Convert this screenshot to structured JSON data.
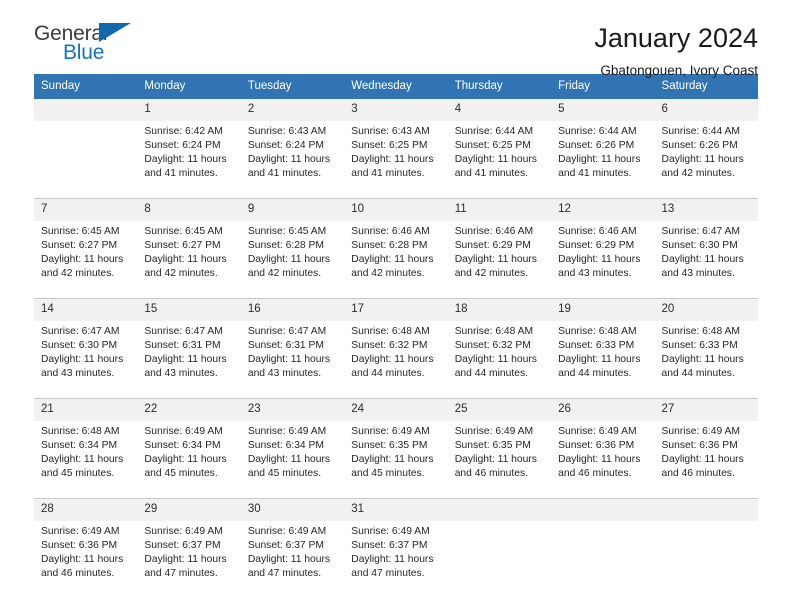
{
  "brand": {
    "name_part1": "General",
    "name_part2": "Blue",
    "triangle_color": "#1268ad"
  },
  "header": {
    "title": "January 2024",
    "subtitle": "Gbatongouen, Ivory Coast",
    "accent_color": "#3174b4",
    "daynum_band_color": "#f1f1f1"
  },
  "calendar": {
    "weekday_headers": [
      "Sunday",
      "Monday",
      "Tuesday",
      "Wednesday",
      "Thursday",
      "Friday",
      "Saturday"
    ],
    "weeks": [
      [
        {
          "day": "",
          "lines": []
        },
        {
          "day": "1",
          "lines": [
            "Sunrise: 6:42 AM",
            "Sunset: 6:24 PM",
            "Daylight: 11 hours",
            "and 41 minutes."
          ]
        },
        {
          "day": "2",
          "lines": [
            "Sunrise: 6:43 AM",
            "Sunset: 6:24 PM",
            "Daylight: 11 hours",
            "and 41 minutes."
          ]
        },
        {
          "day": "3",
          "lines": [
            "Sunrise: 6:43 AM",
            "Sunset: 6:25 PM",
            "Daylight: 11 hours",
            "and 41 minutes."
          ]
        },
        {
          "day": "4",
          "lines": [
            "Sunrise: 6:44 AM",
            "Sunset: 6:25 PM",
            "Daylight: 11 hours",
            "and 41 minutes."
          ]
        },
        {
          "day": "5",
          "lines": [
            "Sunrise: 6:44 AM",
            "Sunset: 6:26 PM",
            "Daylight: 11 hours",
            "and 41 minutes."
          ]
        },
        {
          "day": "6",
          "lines": [
            "Sunrise: 6:44 AM",
            "Sunset: 6:26 PM",
            "Daylight: 11 hours",
            "and 42 minutes."
          ]
        }
      ],
      [
        {
          "day": "7",
          "lines": [
            "Sunrise: 6:45 AM",
            "Sunset: 6:27 PM",
            "Daylight: 11 hours",
            "and 42 minutes."
          ]
        },
        {
          "day": "8",
          "lines": [
            "Sunrise: 6:45 AM",
            "Sunset: 6:27 PM",
            "Daylight: 11 hours",
            "and 42 minutes."
          ]
        },
        {
          "day": "9",
          "lines": [
            "Sunrise: 6:45 AM",
            "Sunset: 6:28 PM",
            "Daylight: 11 hours",
            "and 42 minutes."
          ]
        },
        {
          "day": "10",
          "lines": [
            "Sunrise: 6:46 AM",
            "Sunset: 6:28 PM",
            "Daylight: 11 hours",
            "and 42 minutes."
          ]
        },
        {
          "day": "11",
          "lines": [
            "Sunrise: 6:46 AM",
            "Sunset: 6:29 PM",
            "Daylight: 11 hours",
            "and 42 minutes."
          ]
        },
        {
          "day": "12",
          "lines": [
            "Sunrise: 6:46 AM",
            "Sunset: 6:29 PM",
            "Daylight: 11 hours",
            "and 43 minutes."
          ]
        },
        {
          "day": "13",
          "lines": [
            "Sunrise: 6:47 AM",
            "Sunset: 6:30 PM",
            "Daylight: 11 hours",
            "and 43 minutes."
          ]
        }
      ],
      [
        {
          "day": "14",
          "lines": [
            "Sunrise: 6:47 AM",
            "Sunset: 6:30 PM",
            "Daylight: 11 hours",
            "and 43 minutes."
          ]
        },
        {
          "day": "15",
          "lines": [
            "Sunrise: 6:47 AM",
            "Sunset: 6:31 PM",
            "Daylight: 11 hours",
            "and 43 minutes."
          ]
        },
        {
          "day": "16",
          "lines": [
            "Sunrise: 6:47 AM",
            "Sunset: 6:31 PM",
            "Daylight: 11 hours",
            "and 43 minutes."
          ]
        },
        {
          "day": "17",
          "lines": [
            "Sunrise: 6:48 AM",
            "Sunset: 6:32 PM",
            "Daylight: 11 hours",
            "and 44 minutes."
          ]
        },
        {
          "day": "18",
          "lines": [
            "Sunrise: 6:48 AM",
            "Sunset: 6:32 PM",
            "Daylight: 11 hours",
            "and 44 minutes."
          ]
        },
        {
          "day": "19",
          "lines": [
            "Sunrise: 6:48 AM",
            "Sunset: 6:33 PM",
            "Daylight: 11 hours",
            "and 44 minutes."
          ]
        },
        {
          "day": "20",
          "lines": [
            "Sunrise: 6:48 AM",
            "Sunset: 6:33 PM",
            "Daylight: 11 hours",
            "and 44 minutes."
          ]
        }
      ],
      [
        {
          "day": "21",
          "lines": [
            "Sunrise: 6:48 AM",
            "Sunset: 6:34 PM",
            "Daylight: 11 hours",
            "and 45 minutes."
          ]
        },
        {
          "day": "22",
          "lines": [
            "Sunrise: 6:49 AM",
            "Sunset: 6:34 PM",
            "Daylight: 11 hours",
            "and 45 minutes."
          ]
        },
        {
          "day": "23",
          "lines": [
            "Sunrise: 6:49 AM",
            "Sunset: 6:34 PM",
            "Daylight: 11 hours",
            "and 45 minutes."
          ]
        },
        {
          "day": "24",
          "lines": [
            "Sunrise: 6:49 AM",
            "Sunset: 6:35 PM",
            "Daylight: 11 hours",
            "and 45 minutes."
          ]
        },
        {
          "day": "25",
          "lines": [
            "Sunrise: 6:49 AM",
            "Sunset: 6:35 PM",
            "Daylight: 11 hours",
            "and 46 minutes."
          ]
        },
        {
          "day": "26",
          "lines": [
            "Sunrise: 6:49 AM",
            "Sunset: 6:36 PM",
            "Daylight: 11 hours",
            "and 46 minutes."
          ]
        },
        {
          "day": "27",
          "lines": [
            "Sunrise: 6:49 AM",
            "Sunset: 6:36 PM",
            "Daylight: 11 hours",
            "and 46 minutes."
          ]
        }
      ],
      [
        {
          "day": "28",
          "lines": [
            "Sunrise: 6:49 AM",
            "Sunset: 6:36 PM",
            "Daylight: 11 hours",
            "and 46 minutes."
          ]
        },
        {
          "day": "29",
          "lines": [
            "Sunrise: 6:49 AM",
            "Sunset: 6:37 PM",
            "Daylight: 11 hours",
            "and 47 minutes."
          ]
        },
        {
          "day": "30",
          "lines": [
            "Sunrise: 6:49 AM",
            "Sunset: 6:37 PM",
            "Daylight: 11 hours",
            "and 47 minutes."
          ]
        },
        {
          "day": "31",
          "lines": [
            "Sunrise: 6:49 AM",
            "Sunset: 6:37 PM",
            "Daylight: 11 hours",
            "and 47 minutes."
          ]
        },
        {
          "day": "",
          "lines": []
        },
        {
          "day": "",
          "lines": []
        },
        {
          "day": "",
          "lines": []
        }
      ]
    ]
  }
}
